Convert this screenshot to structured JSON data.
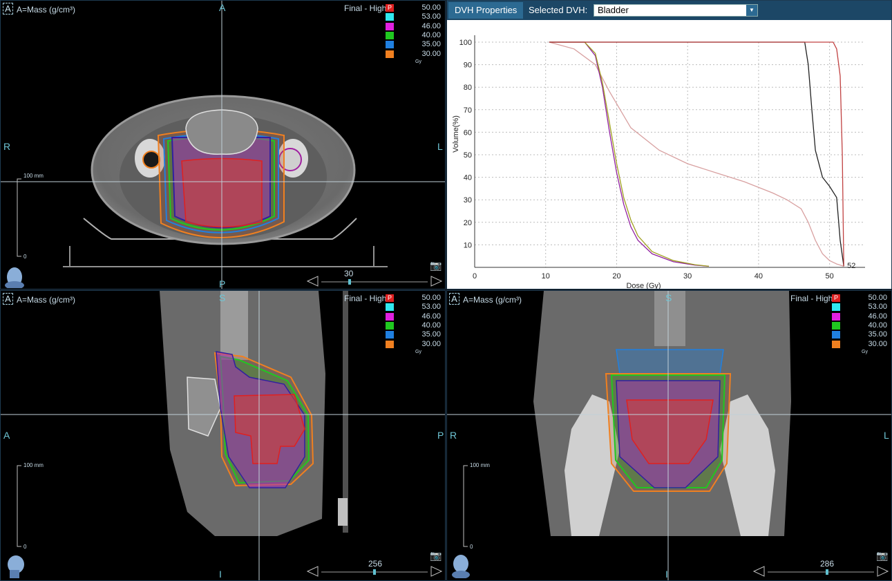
{
  "legend": {
    "title": "Final - High",
    "unit": "Gy",
    "levels": [
      {
        "value": "50.00",
        "color": "#e02020",
        "marker": "P"
      },
      {
        "value": "53.00",
        "color": "#30e8f0",
        "marker": ""
      },
      {
        "value": "46.00",
        "color": "#e020e0",
        "marker": ""
      },
      {
        "value": "40.00",
        "color": "#20c820",
        "marker": ""
      },
      {
        "value": "35.00",
        "color": "#2080e0",
        "marker": ""
      },
      {
        "value": "30.00",
        "color": "#f08020",
        "marker": ""
      }
    ]
  },
  "views": {
    "axial": {
      "header_box": "A",
      "header": "A=Mass (g/cm³)",
      "top": "A",
      "bottom": "P",
      "left": "R",
      "right": "L",
      "slice": "30",
      "scale_top": "100 mm",
      "scale_bottom": "0"
    },
    "sagittal": {
      "header_box": "A",
      "header": "A=Mass (g/cm³)",
      "top": "S",
      "bottom": "I",
      "left": "A",
      "right": "P",
      "slice": "256",
      "scale_top": "100 mm",
      "scale_bottom": "0"
    },
    "coronal": {
      "header_box": "A",
      "header": "A=Mass (g/cm³)",
      "top": "S",
      "bottom": "I",
      "left": "R",
      "right": "L",
      "slice": "286",
      "scale_top": "100 mm",
      "scale_bottom": "0"
    }
  },
  "dvh_panel": {
    "tab_label": "DVH Properties",
    "selected_label": "Selected DVH:",
    "selected_value": "Bladder",
    "end_marker": "52"
  },
  "chart_data": {
    "type": "line",
    "xlabel": "Dose (Gy)",
    "ylabel": "Volume(%)",
    "xlim": [
      0,
      55
    ],
    "ylim": [
      0,
      100
    ],
    "xticks": [
      0,
      10,
      20,
      30,
      40,
      50
    ],
    "yticks": [
      10,
      20,
      30,
      40,
      50,
      60,
      70,
      80,
      90,
      100
    ],
    "grid": true,
    "series": [
      {
        "color": "#d8a0a0",
        "x": [
          10.5,
          14,
          17,
          19,
          22,
          26,
          30,
          34,
          38,
          42,
          44,
          46,
          47,
          48,
          49,
          50,
          51,
          52
        ],
        "y": [
          100,
          97,
          90,
          78,
          62,
          52,
          46,
          42,
          38,
          33,
          30,
          26,
          20,
          12,
          6,
          3,
          1.5,
          0.5
        ]
      },
      {
        "color": "#9020a0",
        "x": [
          10.5,
          15.5,
          17,
          18,
          19,
          20,
          21,
          22,
          23,
          25,
          28,
          31,
          33
        ],
        "y": [
          100,
          100,
          94,
          80,
          60,
          42,
          28,
          18,
          12,
          6,
          2.5,
          1,
          0.5
        ]
      },
      {
        "color": "#a0a020",
        "x": [
          10.5,
          15.5,
          17,
          18,
          19,
          20,
          21,
          22,
          23,
          25,
          28,
          31,
          33
        ],
        "y": [
          100,
          100,
          95,
          82,
          64,
          46,
          31,
          21,
          14,
          7,
          3,
          1.2,
          0.5
        ]
      },
      {
        "color": "#202020",
        "x": [
          10.5,
          46.5,
          47,
          47.5,
          48,
          49,
          50,
          51,
          51.5,
          52
        ],
        "y": [
          100,
          100,
          90,
          70,
          52,
          40,
          36,
          31,
          12,
          0.5
        ]
      },
      {
        "color": "#c04040",
        "x": [
          10.5,
          50.5,
          51,
          51.5,
          51.8,
          52
        ],
        "y": [
          100,
          100,
          97,
          85,
          50,
          0.5
        ]
      }
    ]
  }
}
